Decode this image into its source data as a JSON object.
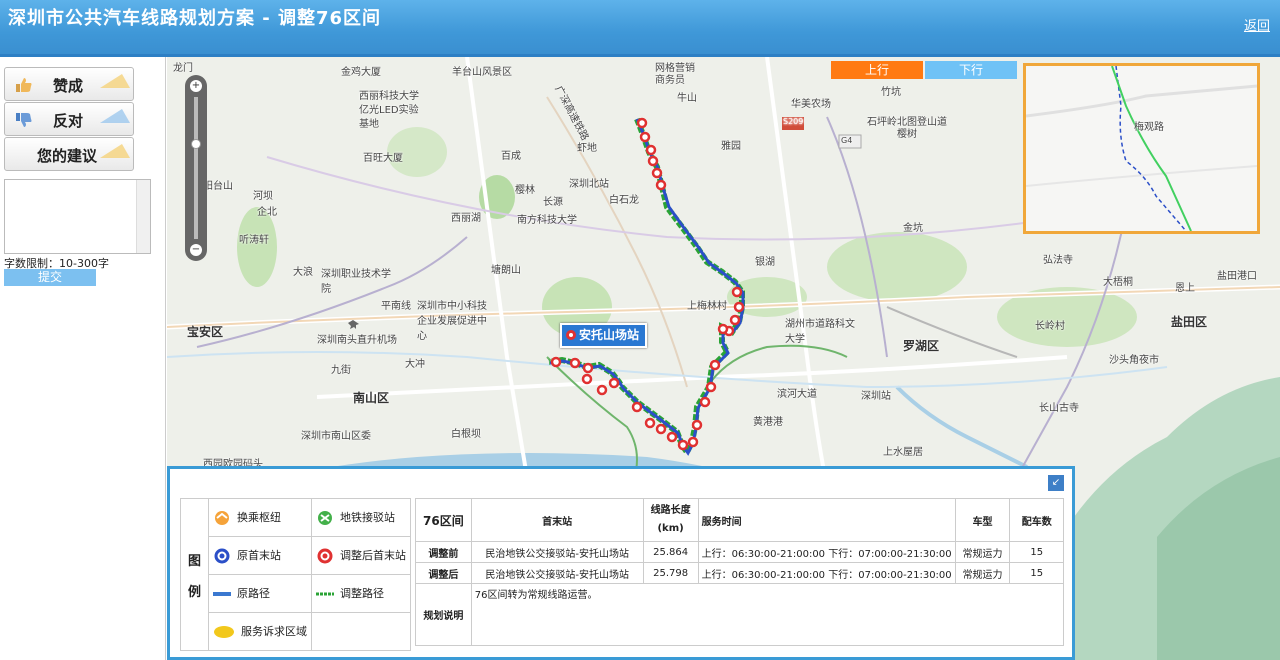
{
  "header": {
    "title": "深圳市公共汽车线路规划方案 - 调整76区间",
    "back_label": "返回"
  },
  "sidebar": {
    "agree_label": "赞成",
    "oppose_label": "反对",
    "suggest_label": "您的建议",
    "limit_text": "字数限制：10-300字",
    "submit_label": "提交"
  },
  "map": {
    "tabs": {
      "up": "上行",
      "down": "下行"
    },
    "inset_label": "梅观路",
    "stop_tag": "安托山场站",
    "labels": [
      "龙门",
      "金鸡大厦",
      "羊台山风景区",
      "网格营销",
      "商务员",
      "竹坑",
      "西丽科技大学",
      "亿光LED实验",
      "基地",
      "牛山",
      "华美农场",
      "石坪岭北图登山道",
      "樱树",
      "百旺大厦",
      "广深高速铁路",
      "S209",
      "G4",
      "百成",
      "虾地",
      "雅园",
      "阳台山",
      "河坝",
      "企北",
      "樱林",
      "长源",
      "深圳北站",
      "白石龙",
      "金坑",
      "西丽湖",
      "南方科技大学",
      "听涛轩",
      "银湖",
      "弘法寺",
      "大浪",
      "深圳职业技术学院",
      "塘朗山",
      "大梧桐",
      "盐田港口",
      "平南线",
      "深圳市中小科技企业发展促进中心",
      "上梅林村",
      "湖州市道路科文大学",
      "深圳南头直升机场",
      "宝安区",
      "罗湖区",
      "长岭村",
      "盐田区",
      "九街",
      "大冲",
      "沙头角夜市",
      "南山区",
      "滨河大道",
      "深圳站",
      "长山古寺",
      "黄港港",
      "深圳市南山区委",
      "白根坝",
      "上水屋居",
      "西园欧园码头",
      "恩上"
    ]
  },
  "legend": {
    "title1": "图",
    "title2": "例",
    "items": [
      "换乘枢纽",
      "地铁接驳站",
      "原首末站",
      "调整后首末站",
      "原路径",
      "调整路径",
      "服务诉求区域"
    ]
  },
  "info_table": {
    "headers": [
      "76区间",
      "首末站",
      "线路长度(km)",
      "服务时间",
      "车型",
      "配车数"
    ],
    "rows": [
      [
        "调整前",
        "民治地铁公交接驳站-安托山场站",
        "25.864",
        "上行：06:30:00-21:00:00 下行：07:00:00-21:30:00",
        "常规运力",
        "15"
      ],
      [
        "调整后",
        "民治地铁公交接驳站-安托山场站",
        "25.798",
        "上行：06:30:00-21:00:00 下行：07:00:00-21:30:00",
        "常规运力",
        "15"
      ]
    ],
    "note_label": "规划说明",
    "note_text": "76区间转为常规线路运营。"
  },
  "colors": {
    "header": "#3f98d8",
    "tab_up": "#ff7a12",
    "tab_down": "#6fc2f6",
    "route_original": "#2b4fc8",
    "route_adjusted": "#2aa335",
    "stop": "#e03131",
    "inset_border": "#f0a73a"
  }
}
